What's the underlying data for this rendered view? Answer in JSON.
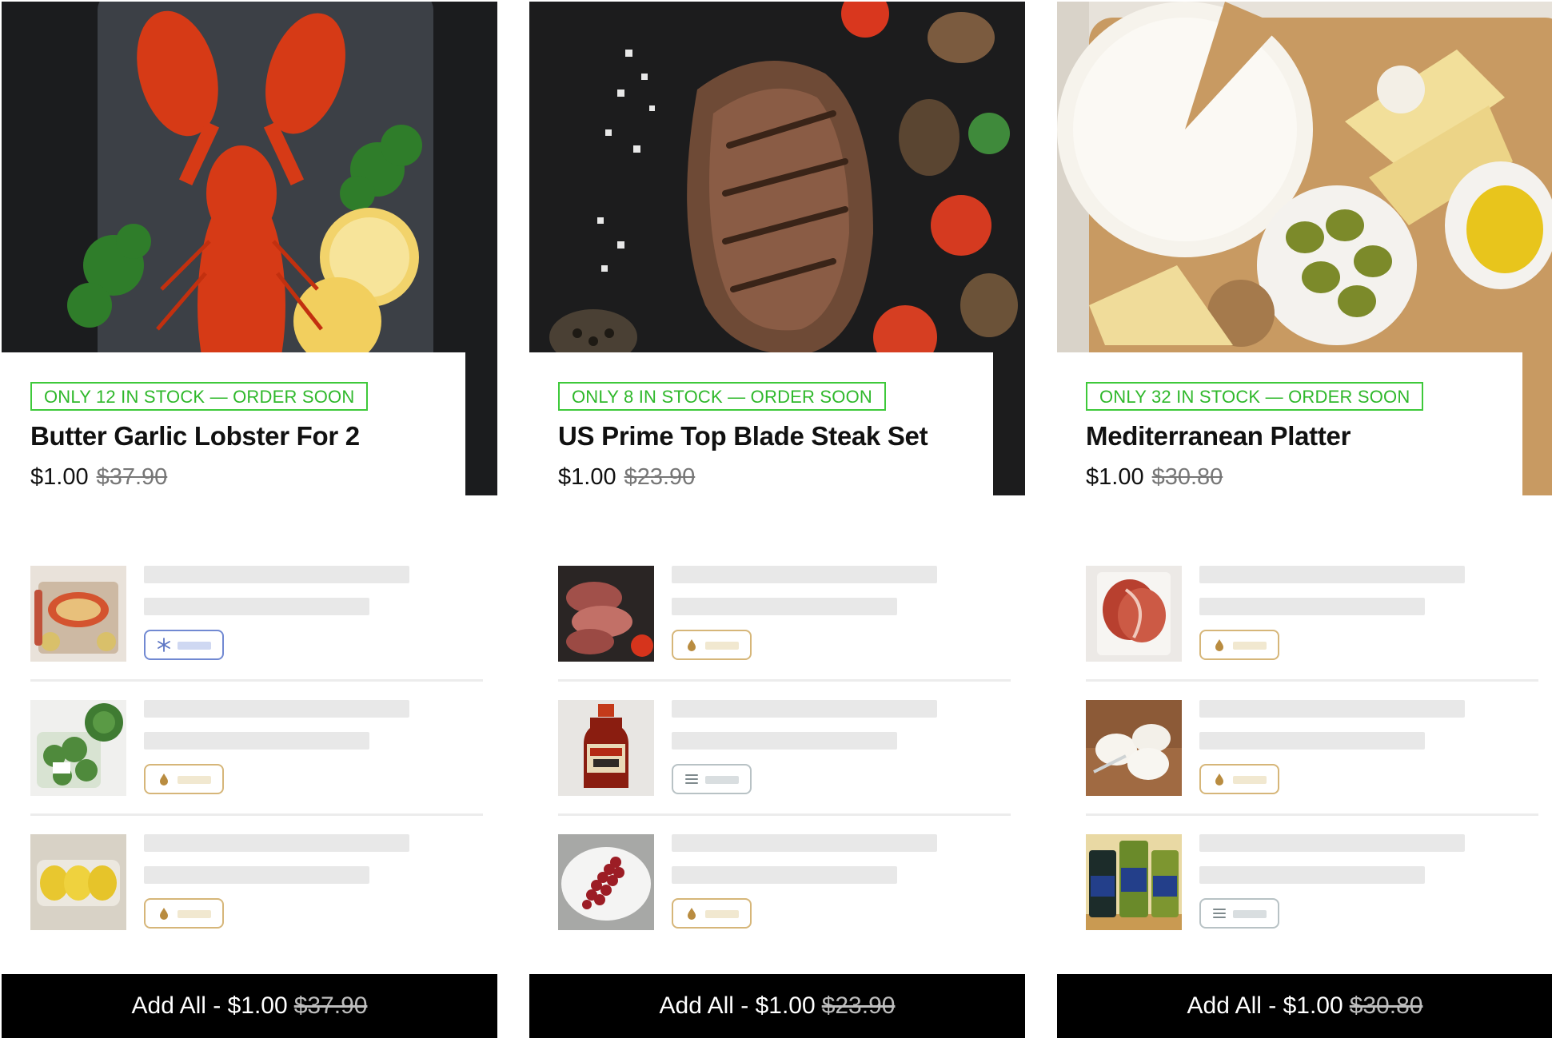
{
  "colors": {
    "stock_badge": "#2fb82b",
    "button_bg": "#000000",
    "skeleton": "#e8e8e8",
    "tag_frozen": "#7189d2",
    "tag_pantry": "#d6b679",
    "tag_other": "#b8c2c5"
  },
  "cards": [
    {
      "stock_text": "ONLY 12 IN STOCK  — ORDER SOON",
      "name": "Butter Garlic Lobster For 2",
      "price": "$1.00",
      "old_price": "$37.90",
      "add_all_label": "Add All - $1.00",
      "add_all_old": "$37.90",
      "items": [
        {
          "photo": "lobster-tray",
          "tag_icon": "snowflake-icon"
        },
        {
          "photo": "salad-greens",
          "tag_icon": "drop-icon"
        },
        {
          "photo": "lemons-pack",
          "tag_icon": "drop-icon"
        }
      ]
    },
    {
      "stock_text": "ONLY 8 IN STOCK  — ORDER SOON",
      "name": "US Prime Top Blade Steak Set",
      "price": "$1.00",
      "old_price": "$23.90",
      "add_all_label": "Add All - $1.00",
      "add_all_old": "$23.90",
      "items": [
        {
          "photo": "sliced-steak",
          "tag_icon": "drop-icon"
        },
        {
          "photo": "bbq-sauce-bottle",
          "tag_icon": "list-icon"
        },
        {
          "photo": "grapes-plate",
          "tag_icon": "drop-icon"
        }
      ]
    },
    {
      "stock_text": "ONLY 32 IN STOCK  — ORDER SOON",
      "name": "Mediterranean Platter",
      "price": "$1.00",
      "old_price": "$30.80",
      "add_all_label": "Add All - $1.00",
      "add_all_old": "$30.80",
      "items": [
        {
          "photo": "prosciutto-pack",
          "tag_icon": "drop-icon"
        },
        {
          "photo": "goat-cheese-board",
          "tag_icon": "drop-icon"
        },
        {
          "photo": "olive-jars",
          "tag_icon": "list-icon"
        }
      ]
    }
  ]
}
